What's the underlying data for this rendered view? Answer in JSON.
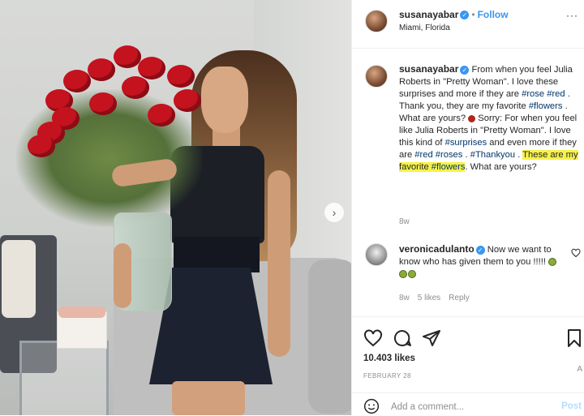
{
  "post": {
    "username": "susanayabar",
    "follow_label": "Follow",
    "location": "Miami, Florida",
    "more_icon": "···"
  },
  "caption": {
    "username": "susanayabar",
    "part1": "From when you feel Julia Roberts in \"Pretty Woman\". I love these surprises and more if they are ",
    "tag1": "#rose",
    "tag2": "#red",
    "part2": ". Thank you, they are my favorite ",
    "tag3": "#flowers",
    "part3": ". What are yours? ",
    "part4": " Sorry: For when you feel like Julia Roberts in \"Pretty Woman\". I love this kind of ",
    "tag4": "#surprises",
    "part5": " and even more if they are ",
    "tag5": "#red",
    "tag6": "#roses",
    "part6": ". ",
    "tag7": "#Thankyou",
    "part7": ". ",
    "highlight_text": "These are my favorite ",
    "tag8": "#flowers",
    "part8": ". What are yours?",
    "time": "8w"
  },
  "comment": {
    "username": "veronicadulanto",
    "text": "Now we want to know who has given them to you !!!!!",
    "time": "8w",
    "likes": "5 likes",
    "reply_label": "Reply"
  },
  "stats": {
    "likes": "10.403 likes",
    "date": "FEBRUARY 28"
  },
  "add_comment": {
    "placeholder": "Add a comment...",
    "post_label": "Post"
  },
  "edge_char": "A"
}
